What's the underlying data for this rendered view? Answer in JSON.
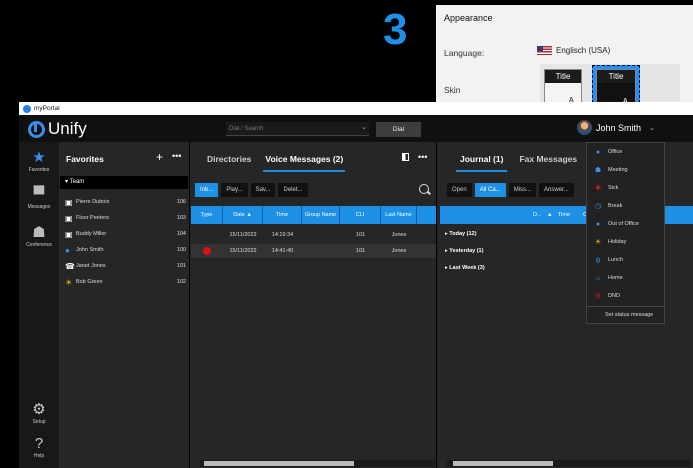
{
  "step_number": "3",
  "appearance": {
    "title": "Appearance",
    "language_label": "Language:",
    "language_value": "Englisch (USA)",
    "skin_label": "Skin",
    "skins": [
      {
        "title": "Title",
        "dots": "...",
        "letter": "A"
      },
      {
        "title": "Title",
        "dots": "...",
        "letter": "A"
      }
    ]
  },
  "window": {
    "title": "myPortal"
  },
  "header": {
    "logo": "Unify",
    "dial_placeholder": "Dial / Search",
    "dial_button": "Dial",
    "user_name": "John Smith"
  },
  "nav": {
    "items": [
      {
        "label": "Favorites",
        "icon": "star-icon"
      },
      {
        "label": "Messages",
        "icon": "messages-icon"
      },
      {
        "label": "Conference",
        "icon": "conference-icon"
      },
      {
        "label": "Setup",
        "icon": "gear-icon"
      },
      {
        "label": "Help",
        "icon": "help-icon"
      }
    ]
  },
  "favorites": {
    "title": "Favorites",
    "team_label": "Team",
    "rows": [
      {
        "name": "Pierre Dubois",
        "ext": "106",
        "icon": "contact-card-icon"
      },
      {
        "name": "Floor Peeters",
        "ext": "103",
        "icon": "contact-card-icon"
      },
      {
        "name": "Buddy Miller",
        "ext": "104",
        "icon": "contact-card-icon"
      },
      {
        "name": "John Smith",
        "ext": "100",
        "icon": "person-icon"
      },
      {
        "name": "Janet Jones",
        "ext": "101",
        "icon": "phone-icon"
      },
      {
        "name": "Bob Green",
        "ext": "102",
        "icon": "sun-icon"
      }
    ]
  },
  "voicemail": {
    "tab_directories": "Directories",
    "tab_voicemail": "Voice Messages (2)",
    "filters": [
      "Inb...",
      "Play...",
      "Sav...",
      "Delet..."
    ],
    "columns": [
      "Type",
      "Date ▲",
      "Time",
      "Group Name",
      "CLI",
      "Last Name"
    ],
    "rows": [
      {
        "type": "",
        "date": "15/11/2022",
        "time": "14:19:34",
        "group": "",
        "cli": "101",
        "last_name": "Jones"
      },
      {
        "type": "red-dot",
        "date": "15/11/2022",
        "time": "14:41:40",
        "group": "",
        "cli": "101",
        "last_name": "Jones"
      }
    ]
  },
  "journal": {
    "tab_journal": "Journal (1)",
    "tab_fax": "Fax Messages",
    "filters": [
      "Open",
      "All Ca...",
      "Miss...",
      "Answer..."
    ],
    "columns": [
      "D...",
      "▲",
      "Time",
      "Ca"
    ],
    "groups": [
      "Today (12)",
      "Yesterday (1)",
      "Last Week (3)"
    ]
  },
  "status_menu": {
    "items": [
      {
        "label": "Office",
        "icon": "office-icon",
        "color": "#3a8fe8"
      },
      {
        "label": "Meeting",
        "icon": "meeting-icon",
        "color": "#3a8fe8"
      },
      {
        "label": "Sick",
        "icon": "sick-icon",
        "color": "#e02020"
      },
      {
        "label": "Break",
        "icon": "break-icon",
        "color": "#3a8fe8"
      },
      {
        "label": "Out of Office",
        "icon": "out-of-office-icon",
        "color": "#3a8fe8"
      },
      {
        "label": "Holiday",
        "icon": "holiday-icon",
        "color": "#f5c400"
      },
      {
        "label": "Lunch",
        "icon": "lunch-icon",
        "color": "#3a8fe8"
      },
      {
        "label": "Home",
        "icon": "home-icon",
        "color": "#3a8fe8"
      },
      {
        "label": "DND",
        "icon": "dnd-icon",
        "color": "#e02020"
      }
    ],
    "footer": "Set status message"
  },
  "colors": {
    "accent": "#1e90e6",
    "background": "#222222"
  }
}
